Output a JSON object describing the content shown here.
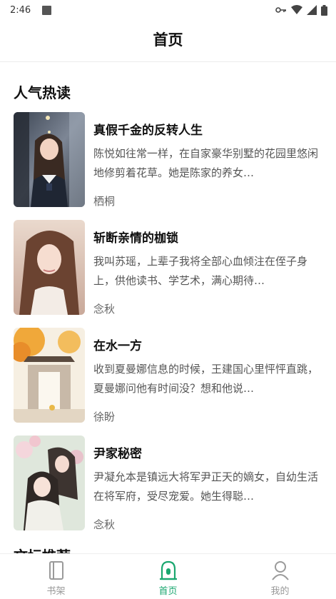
{
  "status_bar": {
    "time": "2:46"
  },
  "header": {
    "title": "首页"
  },
  "section": {
    "title": "人气热读",
    "next_title": "文坛推荐"
  },
  "books": [
    {
      "title": "真假千金的反转人生",
      "description": "陈悦如往常一样，在自家豪华别墅的花园里悠闲地修剪着花草。她是陈家的养女…",
      "author": "栖桐"
    },
    {
      "title": "斩断亲情的枷锁",
      "description": "我叫苏瑶，上辈子我将全部心血倾注在侄子身上，供他读书、学艺术，满心期待…",
      "author": "念秋"
    },
    {
      "title": "在水一方",
      "description": "收到夏曼娜信息的时候，王建国心里怦怦直跳，夏曼娜问他有时间没？想和他说…",
      "author": "徐盼"
    },
    {
      "title": "尹家秘密",
      "description": "尹凝允本是镇远大将军尹正天的嫡女，自幼生活在将军府，受尽宠爱。她生得聪…",
      "author": "念秋"
    }
  ],
  "tabs": [
    {
      "label": "书架",
      "icon": "bookshelf-icon",
      "active": false
    },
    {
      "label": "首页",
      "icon": "home-icon",
      "active": true
    },
    {
      "label": "我的",
      "icon": "profile-icon",
      "active": false
    }
  ],
  "colors": {
    "accent": "#1aa76f",
    "inactive": "#999999"
  }
}
